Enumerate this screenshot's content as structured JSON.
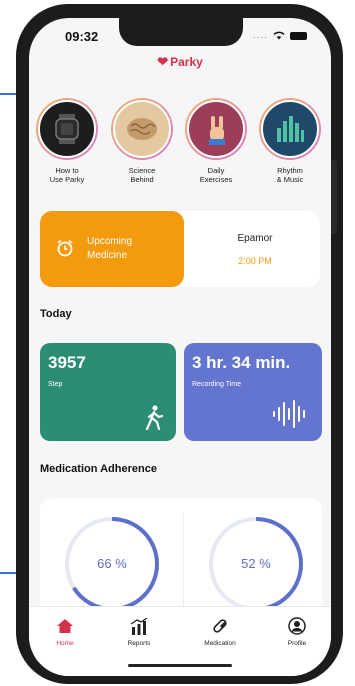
{
  "status_bar": {
    "time": "09:32"
  },
  "app": {
    "brand": "Parky",
    "brand_color": "#d3324b"
  },
  "stories": [
    {
      "label": "How to\nUse Parky",
      "icon": "watch-icon"
    },
    {
      "label": "Science\nBehind",
      "icon": "brain-icon"
    },
    {
      "label": "Daily\nExercises",
      "icon": "hand-icon"
    },
    {
      "label": "Rhythm\n& Music",
      "icon": "equalizer-icon"
    }
  ],
  "upcoming": {
    "title": "Upcoming Medicine",
    "medicine": "Epamor",
    "time": "2:00 PM",
    "accent": "#f49b0d"
  },
  "today": {
    "heading": "Today",
    "steps": {
      "value": "3957",
      "label": "Step",
      "color": "#2c8d74"
    },
    "recording": {
      "value": "3 hr. 34 min.",
      "label": "Recording Time",
      "color": "#6375cf"
    }
  },
  "adherence": {
    "heading": "Medication Adherence",
    "items": [
      {
        "value": "66 %",
        "fraction": 0.66
      },
      {
        "value": "52 %",
        "fraction": 0.52
      }
    ],
    "ring_color": "#5d6fc9"
  },
  "tabs": [
    {
      "label": "Home",
      "icon": "home-icon",
      "active": true
    },
    {
      "label": "Reports",
      "icon": "reports-icon"
    },
    {
      "label": "Medication",
      "icon": "pill-icon"
    },
    {
      "label": "Profile",
      "icon": "profile-icon"
    }
  ]
}
